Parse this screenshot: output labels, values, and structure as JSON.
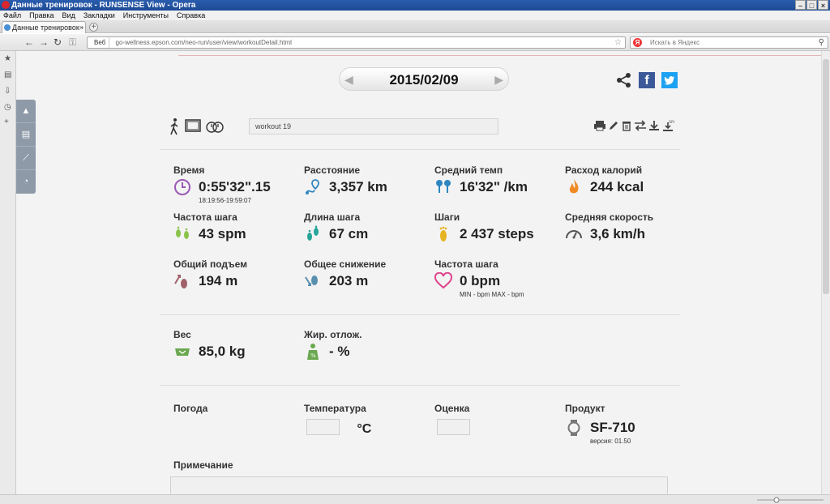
{
  "window": {
    "title": "Данные тренировок - RUNSENSE View - Opera",
    "menu": [
      "Файл",
      "Правка",
      "Вид",
      "Закладки",
      "Инструменты",
      "Справка"
    ]
  },
  "tab": {
    "label": "Данные тренировок - R..."
  },
  "address": {
    "badge": "Веб",
    "url": "go-wellness.epson.com/neo-run/user/view/workoutDetail.html",
    "search_placeholder": "Искать в Яндекс"
  },
  "workout": {
    "date": "2015/02/09",
    "name": "workout 19"
  },
  "stats": {
    "time": {
      "label": "Время",
      "value": "0:55'32\".15",
      "sub": "18:19:56-19:59:07"
    },
    "distance": {
      "label": "Расстояние",
      "value": "3,357 km"
    },
    "pace": {
      "label": "Средний темп",
      "value": "16'32\" /km"
    },
    "calories": {
      "label": "Расход калорий",
      "value": "244 kcal"
    },
    "cadence": {
      "label": "Частота шага",
      "value": "43 spm"
    },
    "stride": {
      "label": "Длина шага",
      "value": "67 cm"
    },
    "steps": {
      "label": "Шаги",
      "value": "2 437 steps"
    },
    "speed": {
      "label": "Средняя скорость",
      "value": "3,6 km/h"
    },
    "ascent": {
      "label": "Общий подъем",
      "value": "194 m"
    },
    "descent": {
      "label": "Общее снижение",
      "value": "203 m"
    },
    "heart": {
      "label": "Частота шага",
      "value": "0 bpm",
      "sub": "MIN - bpm MAX - bpm"
    }
  },
  "body": {
    "weight": {
      "label": "Вес",
      "value": "85,0 kg"
    },
    "fat": {
      "label": "Жир. отлож.",
      "value": "- %"
    }
  },
  "conditions": {
    "weather": {
      "label": "Погода"
    },
    "temperature": {
      "label": "Температура",
      "unit": "°C"
    },
    "rating": {
      "label": "Оценка"
    },
    "product": {
      "label": "Продукт",
      "value": "SF-710",
      "version": "версия: 01.50"
    }
  },
  "notes": {
    "label": "Примечание"
  },
  "colors": {
    "facebook": "#3b5998",
    "twitter": "#1da1f2",
    "sidebar": "#8e9aa8",
    "time_icon": "#9b59b6",
    "distance_icon": "#2e86c1",
    "calorie_icon": "#f08a24",
    "heart_icon": "#e0448e"
  }
}
